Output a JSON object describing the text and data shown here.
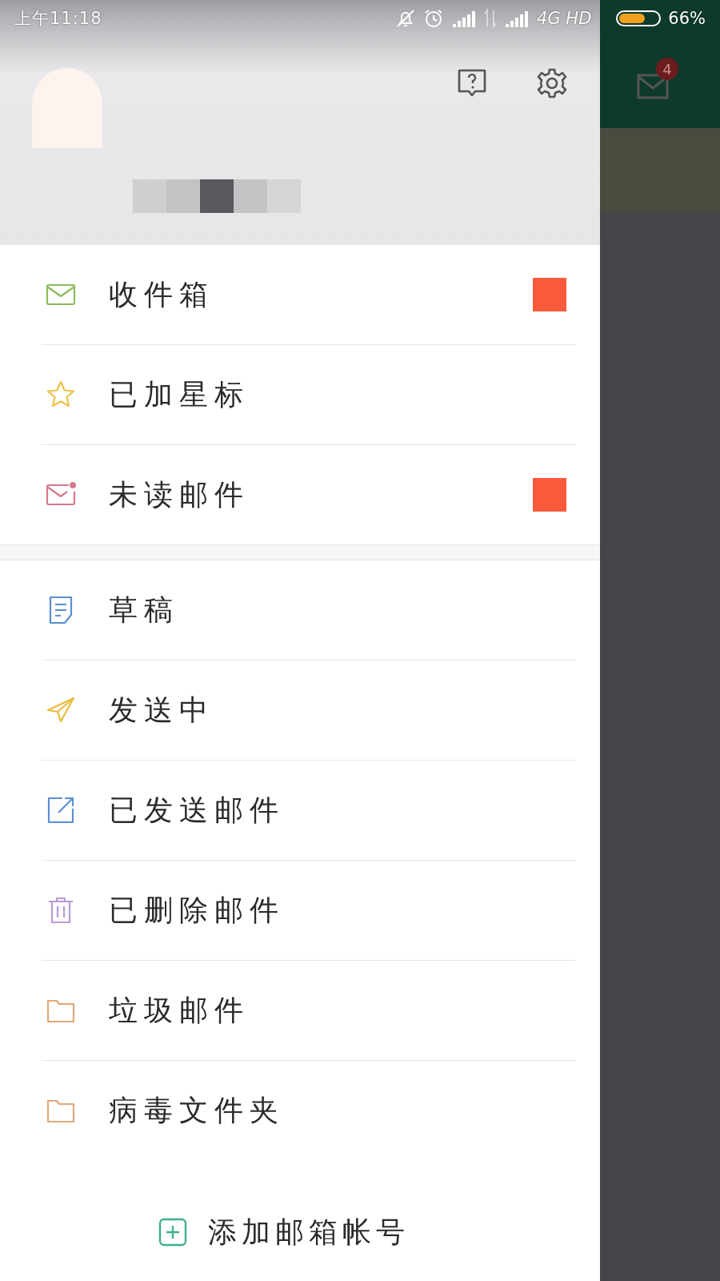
{
  "status_bar": {
    "time": "上午11:18",
    "network": "4G HD",
    "battery": {
      "level": 0.66,
      "reading": "66%"
    }
  },
  "drawer": {
    "folders": [
      {
        "kind": "inbox",
        "label": "收件箱",
        "badge": true
      },
      {
        "kind": "starred",
        "label": "已加星标",
        "badge": false
      },
      {
        "kind": "unread",
        "label": "未读邮件",
        "badge": true
      },
      {
        "kind": "drafts",
        "label": "草稿",
        "badge": false
      },
      {
        "kind": "sending",
        "label": "发送中",
        "badge": false
      },
      {
        "kind": "sent",
        "label": "已发送邮件",
        "badge": false
      },
      {
        "kind": "deleted",
        "label": "已删除邮件",
        "badge": false
      },
      {
        "kind": "junk",
        "label": "垃圾邮件",
        "badge": false
      },
      {
        "kind": "virus",
        "label": "病毒文件夹",
        "badge": false
      }
    ],
    "add_account": "添加邮箱帐号"
  },
  "background_app": {
    "unread_count": "4"
  }
}
